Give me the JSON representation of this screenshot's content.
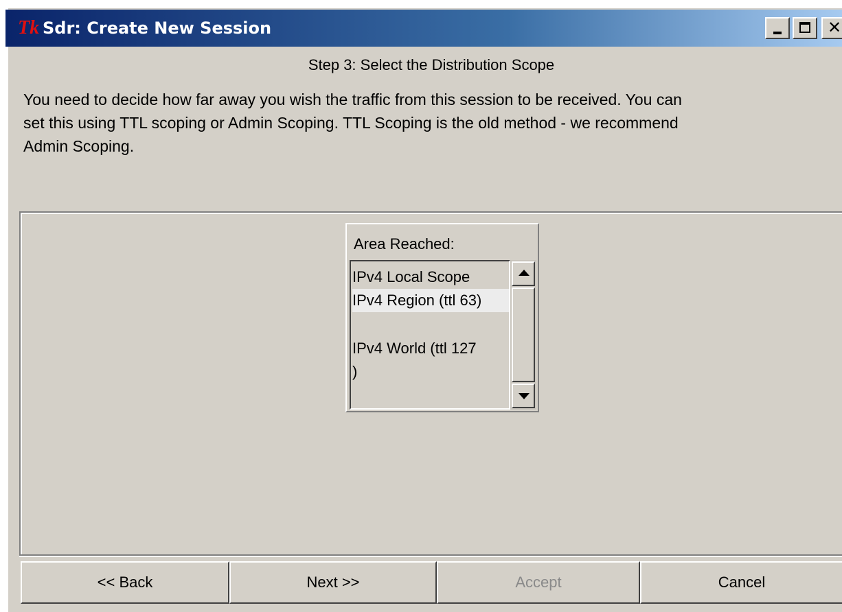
{
  "window": {
    "title": "Sdr: Create New Session",
    "logo_text": "Tk"
  },
  "step": {
    "title": "Step 3: Select the Distribution Scope"
  },
  "description": {
    "line1": "You need to decide how far away you wish the traffic from this session to be received.  You can",
    "line2": "set this using TTL scoping or Admin Scoping.  TTL Scoping is the old method - we recommend",
    "line3": "Admin Scoping."
  },
  "scope": {
    "label": "Area Reached:",
    "items": [
      {
        "label": "IPv4 Local Scope"
      },
      {
        "label": "IPv4 Region (ttl 63)"
      },
      {
        "label": "IPv4 World (ttl 127",
        "continuation": ")"
      }
    ],
    "selected": "IPv4 Region (ttl 63)"
  },
  "buttons": {
    "back": "<< Back",
    "next": "Next >>",
    "accept": "Accept",
    "cancel": "Cancel"
  },
  "colors": {
    "titlebar_start": "#0a246a",
    "titlebar_end": "#a6caf0",
    "face": "#d4d0c8",
    "disabled_text": "#8a8a8a"
  }
}
